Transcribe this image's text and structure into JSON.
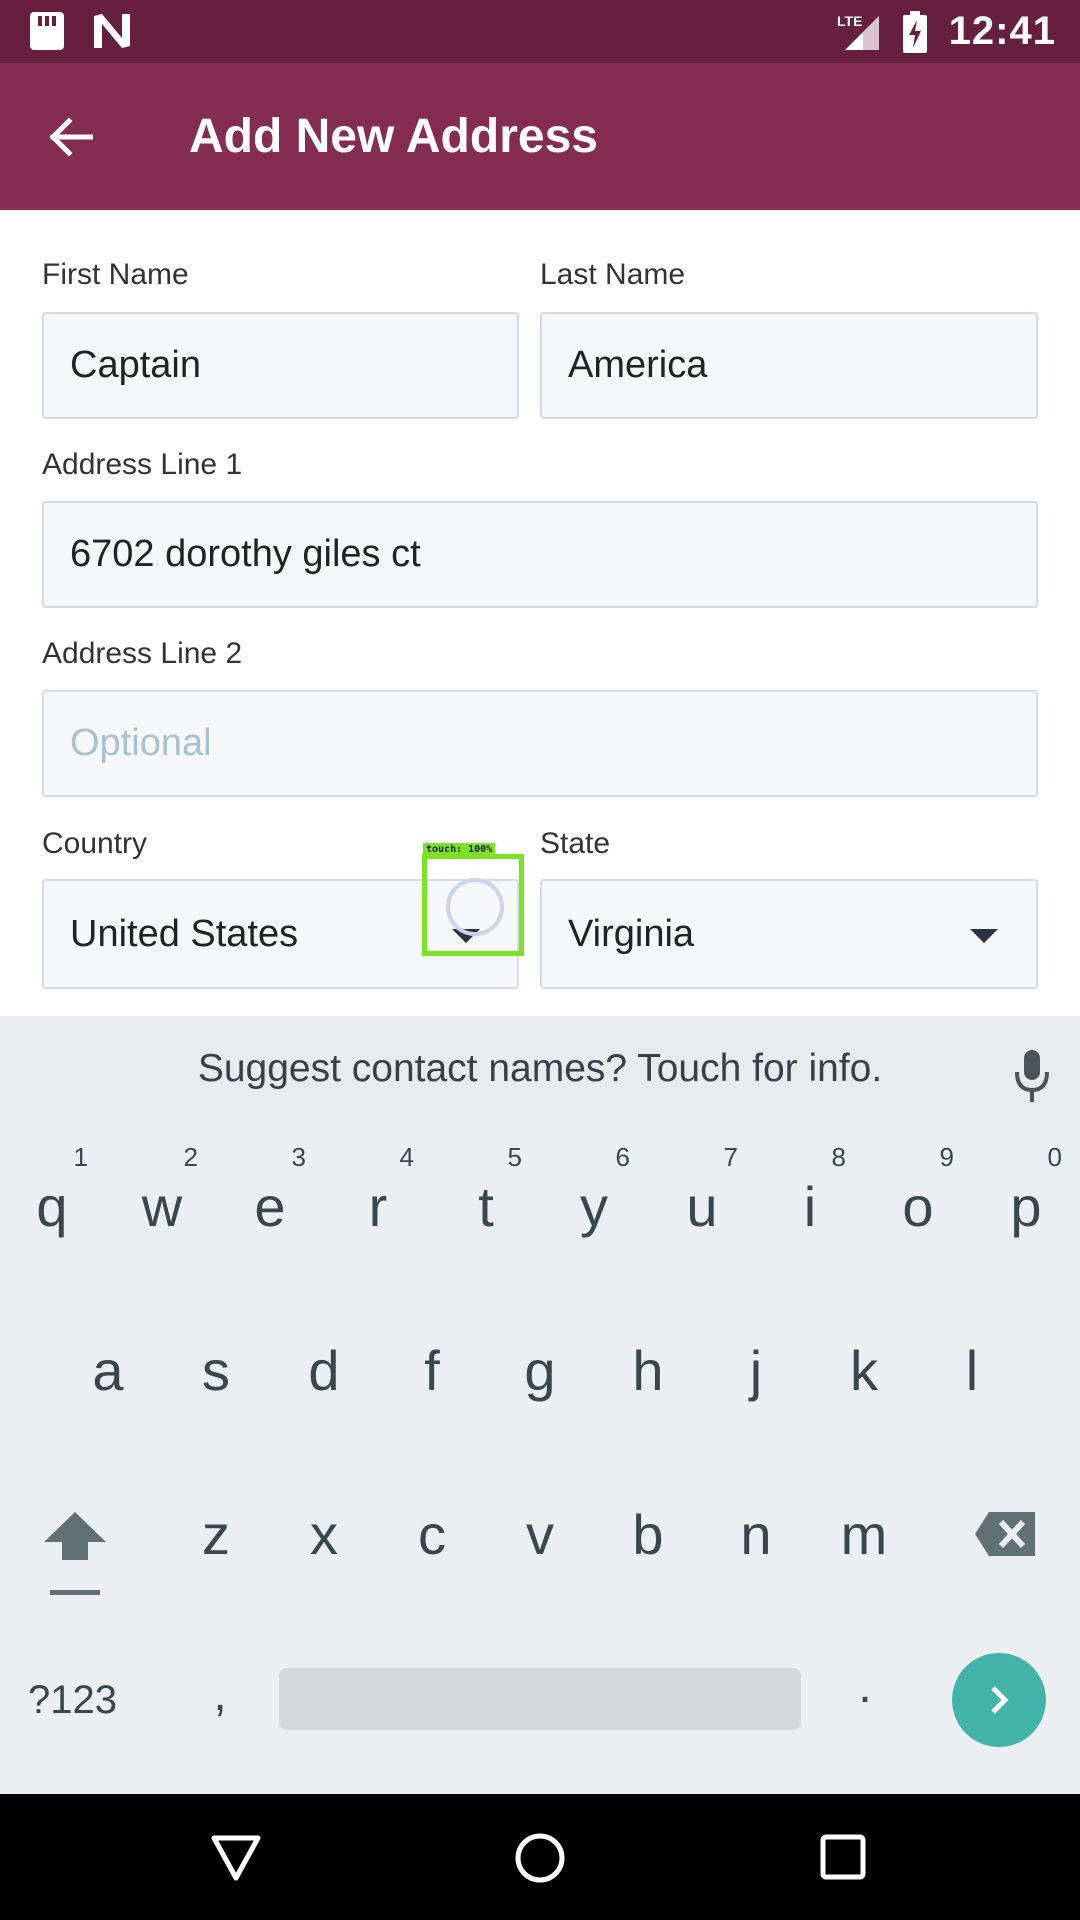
{
  "status_bar": {
    "time": "12:41",
    "network": "LTE",
    "icons": [
      "sd-card-icon",
      "n-notification-icon",
      "signal-icon",
      "battery-charging-icon"
    ]
  },
  "app_bar": {
    "back_icon": "arrow-left-icon",
    "title": "Add New Address"
  },
  "form": {
    "first_name": {
      "label": "First Name",
      "value": "Captain"
    },
    "last_name": {
      "label": "Last Name",
      "value": "America"
    },
    "address_line_1": {
      "label": "Address Line 1",
      "value": "6702 dorothy giles ct"
    },
    "address_line_2": {
      "label": "Address Line 2",
      "value": "",
      "placeholder": "Optional"
    },
    "country": {
      "label": "Country",
      "value": "United States"
    },
    "state": {
      "label": "State",
      "value": "Virginia"
    }
  },
  "touch_overlay": {
    "label": "touch: 100%"
  },
  "keyboard": {
    "suggestion": "Suggest contact names? Touch for info.",
    "row1": [
      {
        "ch": "q",
        "num": "1"
      },
      {
        "ch": "w",
        "num": "2"
      },
      {
        "ch": "e",
        "num": "3"
      },
      {
        "ch": "r",
        "num": "4"
      },
      {
        "ch": "t",
        "num": "5"
      },
      {
        "ch": "y",
        "num": "6"
      },
      {
        "ch": "u",
        "num": "7"
      },
      {
        "ch": "i",
        "num": "8"
      },
      {
        "ch": "o",
        "num": "9"
      },
      {
        "ch": "p",
        "num": "0"
      }
    ],
    "row2": [
      "a",
      "s",
      "d",
      "f",
      "g",
      "h",
      "j",
      "k",
      "l"
    ],
    "row3": [
      "z",
      "x",
      "c",
      "v",
      "b",
      "n",
      "m"
    ],
    "symbols_key": "?123",
    "comma_key": ",",
    "period_key": "."
  },
  "colors": {
    "status_bar": "#661f3e",
    "app_bar": "#852c51",
    "enter_key": "#42b3a9",
    "touch_highlight": "#7be321"
  }
}
